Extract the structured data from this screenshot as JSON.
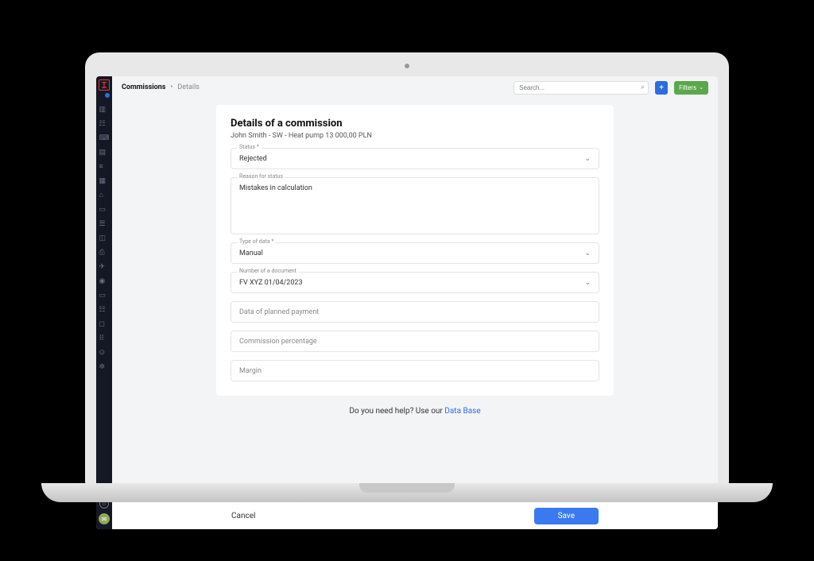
{
  "breadcrumb": {
    "crumb1": "Commissions",
    "crumb2": "Details"
  },
  "search": {
    "placeholder": "Search..."
  },
  "add_label": "+",
  "filters_label": "Filters",
  "card": {
    "title": "Details of a commission",
    "subtitle": "John Smith - SW - Heat pump 13 000,00 PLN",
    "status": {
      "label": "Status *",
      "value": "Rejected"
    },
    "reason": {
      "label": "Reason for status",
      "value": "Mistakes in calculation"
    },
    "type_of_data": {
      "label": "Type of data *",
      "value": "Manual"
    },
    "doc_number": {
      "label": "Number of a document",
      "value": "FV XYZ 01/04/2023"
    },
    "planned_payment": {
      "placeholder": "Data of planned payment"
    },
    "commission_pct": {
      "placeholder": "Commission percentage"
    },
    "margin": {
      "placeholder": "Margin"
    }
  },
  "help": {
    "text": "Do you need help? Use our ",
    "link": "Data Base"
  },
  "actions": {
    "cancel": "Cancel",
    "save": "Save"
  }
}
